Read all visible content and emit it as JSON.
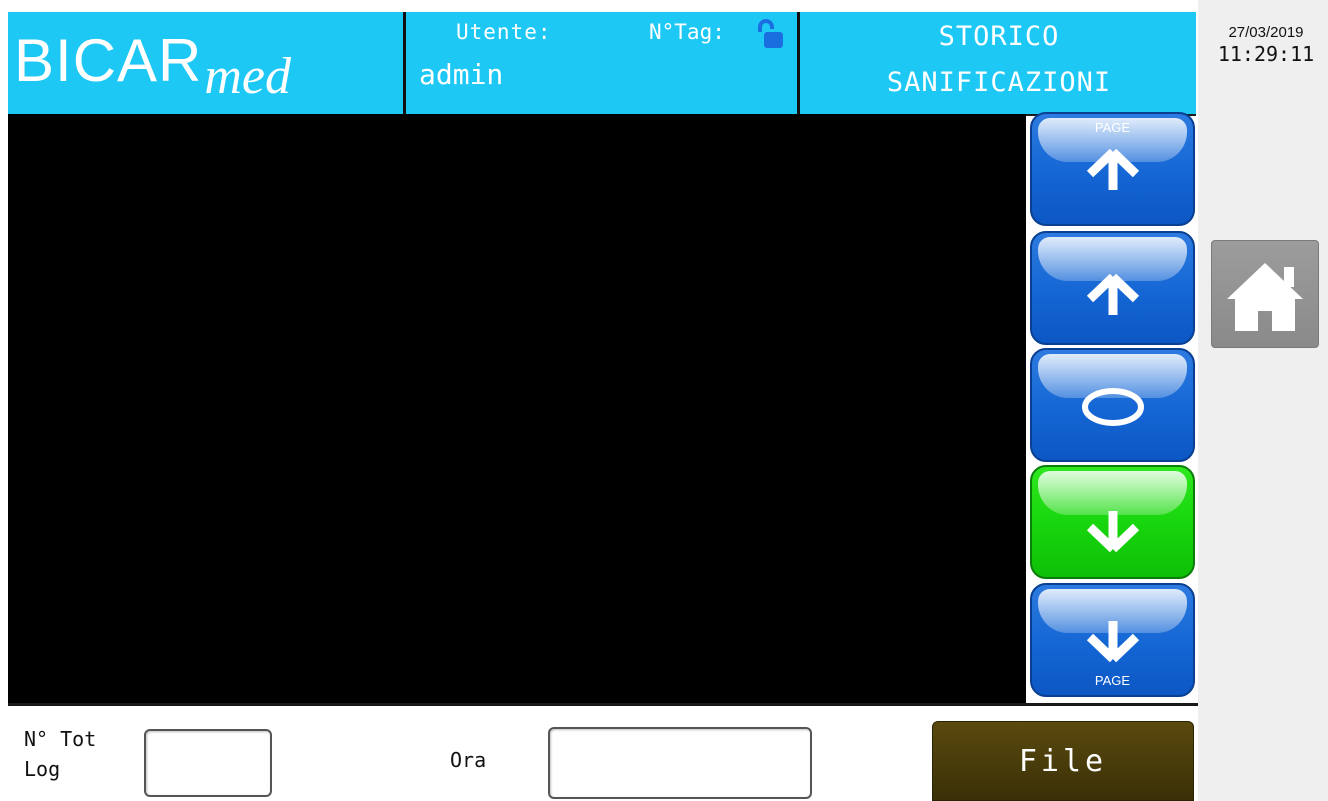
{
  "header": {
    "logo_main": "BICAR",
    "logo_sub": "med",
    "user_label": "Utente:",
    "user_value": "admin",
    "tag_label": "N°Tag:",
    "title_line1": "STORICO",
    "title_line2": "SANIFICAZIONI",
    "lock_icon": "unlocked-padlock-icon",
    "accent": "#1ec8f5"
  },
  "clock": {
    "date": "27/03/2019",
    "time": "11:29:11"
  },
  "nav": {
    "home_icon": "home-icon"
  },
  "scroll_buttons": {
    "page_up_label": "PAGE",
    "page_down_label": "PAGE",
    "colors": {
      "blue": "#1466d4",
      "green": "#16d40c"
    }
  },
  "footer": {
    "ntot_label": "N° Tot\nLog",
    "ntot_value": "",
    "ora_label": "Ora",
    "ora_value": "",
    "file_button": "File"
  }
}
